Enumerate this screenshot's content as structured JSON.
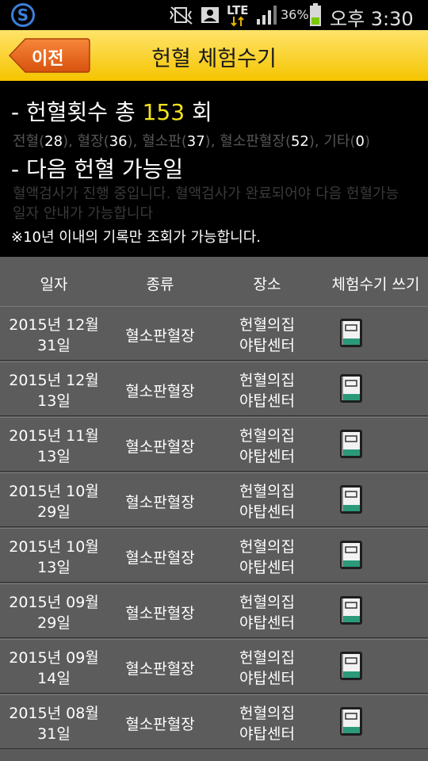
{
  "status_bar": {
    "network": "LTE",
    "battery": "36%",
    "time": "오후 3:30"
  },
  "header": {
    "back_label": "이전",
    "title": "헌혈 체험수기"
  },
  "summary": {
    "total_prefix": "- 헌혈횟수 총 ",
    "total_count": "153",
    "total_suffix": " 회",
    "breakdown": [
      {
        "label": "전혈(",
        "count": "28",
        "close": "), "
      },
      {
        "label": "혈장(",
        "count": "36",
        "close": "), "
      },
      {
        "label": "혈소판(",
        "count": "37",
        "close": "), "
      },
      {
        "label": "혈소판혈장(",
        "count": "52",
        "close": "), "
      },
      {
        "label": "기타(",
        "count": "0",
        "close": ")"
      }
    ],
    "next_title": "- 다음 헌혈 가능일",
    "next_message": "혈액검사가 진행 중입니다. 혈액검사가 완료되어야 다음 헌혈가능일자 안내가 가능합니다",
    "notice": "※10년 이내의 기록만 조회가 가능합니다."
  },
  "table": {
    "headers": [
      "일자",
      "종류",
      "장소",
      "체험수기 쓰기"
    ],
    "rows": [
      {
        "date1": "2015년 12월",
        "date2": "31일",
        "type": "혈소판혈장",
        "place1": "헌혈의집",
        "place2": "야탑센터"
      },
      {
        "date1": "2015년 12월",
        "date2": "13일",
        "type": "혈소판혈장",
        "place1": "헌혈의집",
        "place2": "야탑센터"
      },
      {
        "date1": "2015년 11월",
        "date2": "13일",
        "type": "혈소판혈장",
        "place1": "헌혈의집",
        "place2": "야탑센터"
      },
      {
        "date1": "2015년 10월",
        "date2": "29일",
        "type": "혈소판혈장",
        "place1": "헌혈의집",
        "place2": "야탑센터"
      },
      {
        "date1": "2015년 10월",
        "date2": "13일",
        "type": "혈소판혈장",
        "place1": "헌혈의집",
        "place2": "야탑센터"
      },
      {
        "date1": "2015년 09월",
        "date2": "29일",
        "type": "혈소판혈장",
        "place1": "헌혈의집",
        "place2": "야탑센터"
      },
      {
        "date1": "2015년 09월",
        "date2": "14일",
        "type": "혈소판혈장",
        "place1": "헌혈의집",
        "place2": "야탑센터"
      },
      {
        "date1": "2015년 08월",
        "date2": "31일",
        "type": "혈소판혈장",
        "place1": "헌혈의집",
        "place2": "야탑센터"
      }
    ]
  },
  "icons": {
    "write_icon": "notebook-icon",
    "back_icon": "arrow-left-icon"
  },
  "colors": {
    "accent_yellow": "#f4e31d",
    "title_bar": "#f5c400",
    "back_button": "#e8641b"
  }
}
